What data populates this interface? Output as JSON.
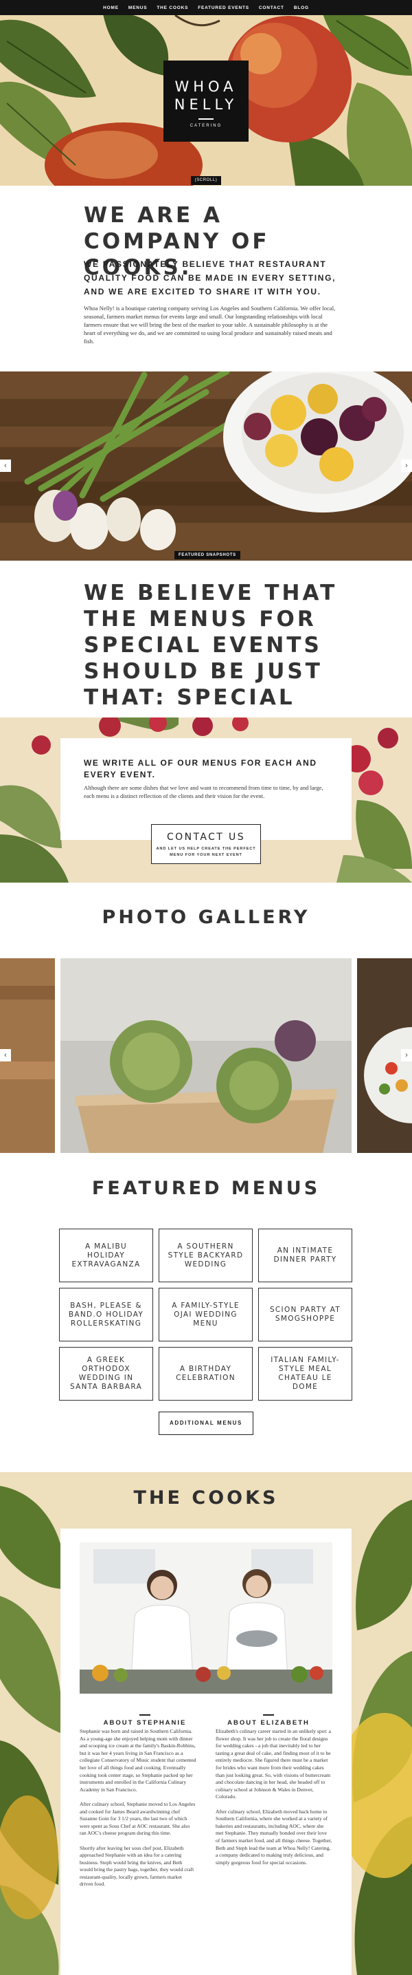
{
  "nav": {
    "items": [
      "HOME",
      "MENUS",
      "THE COOKS",
      "FEATURED EVENTS",
      "CONTACT",
      "BLOG"
    ]
  },
  "hero": {
    "logo_line1": "WHOA",
    "logo_line2": "NELLY",
    "logo_sub": "CATERING",
    "scroll_label": "(SCROLL)"
  },
  "intro": {
    "heading": "WE ARE A COMPANY OF COOKS.",
    "lead": "WE PASSIONATELY BELIEVE THAT RESTAURANT QUALITY FOOD CAN BE MADE IN EVERY SETTING, AND WE ARE EXCITED TO SHARE IT WITH YOU.",
    "body": "Whoa Nelly! is a boutique catering company serving Los Angeles and Southern California. We offer local, seasonal, farmers market menus for events large and small. Our longstanding relationships with local farmers ensure that we will bring the best of the market to your table. A sustainable philosophy is at the heart of everything we do, and we are committed to using local produce and sustainably raised meats and fish."
  },
  "band1": {
    "tag": "FEATURED SNAPSHOTS",
    "arrow_left": "‹",
    "arrow_right": "›"
  },
  "believe": {
    "heading": "WE BELIEVE THAT THE MENUS FOR SPECIAL EVENTS SHOULD BE JUST THAT: SPECIAL"
  },
  "menus_feature": {
    "title": "WE WRITE ALL OF OUR MENUS FOR EACH AND EVERY EVENT.",
    "text": "Although there are some dishes that we love and want to recommend from time to time, by and large, each menu is a distinct reflection of the clients and their vision for the event.",
    "contact_label": "CONTACT US",
    "contact_sub": "AND LET US HELP CREATE THE PERFECT MENU FOR YOUR NEXT EVENT"
  },
  "gallery": {
    "title": "PHOTO GALLERY",
    "arrow_left": "‹",
    "arrow_right": "›"
  },
  "featured_menus": {
    "title": "FEATURED MENUS",
    "items": [
      "A MALIBU HOLIDAY EXTRAVAGANZA",
      "A SOUTHERN STYLE BACKYARD WEDDING",
      "AN INTIMATE DINNER PARTY",
      "BASH, PLEASE & BAND.O HOLIDAY ROLLERSKATING",
      "A FAMILY-STYLE OJAI WEDDING MENU",
      "SCION PARTY AT SMOGSHOPPE",
      "A GREEK ORTHODOX WEDDING IN SANTA BARBARA",
      "A BIRTHDAY CELEBRATION",
      "ITALIAN FAMILY-STYLE MEAL CHATEAU LE DOME"
    ],
    "more_label": "ADDITIONAL MENUS"
  },
  "cooks": {
    "title": "THE COOKS",
    "about_left": "ABOUT STEPHANIE",
    "about_right": "ABOUT ELIZABETH",
    "left_paragraphs": [
      "Stephanie was born and raised in Southern California. As a young-age she enjoyed helping mom with dinner and scooping ice cream at the family's Baskin-Robbins, but it was her 4 years living in San Francisco as a collegiate Conservatory of Music student that cemented her love of all things food and cooking. Eventually cooking took center stage, so Stephanie packed up her instruments and enrolled in the California Culinary Academy in San Francisco.",
      "After culinary school, Stephanie moved to Los Angeles and cooked for James Beard awardwinning chef Suzanne Goin for 3 1/2 years, the last two of which were spent as Sous Chef at AOC restaurant. She also ran AOC's cheese program during this time.",
      "Shortly after leaving her sous chef post, Elizabeth approached Stephanie with an idea for a catering business. Steph would bring the knives, and Beth would bring the pastry bags, together, they would craft restaurant-quality, locally grown, farmers market driven food."
    ],
    "right_paragraphs": [
      "Elizabeth's culinary career started in an unlikely spot: a flower shop. It was her job to create the floral designs for wedding cakes - a job that inevitably led to her tasting a great deal of cake, and finding most of it to be entirely mediocre. She figured there must be a market for brides who want more from their wedding cakes than just looking great. So, with visions of buttercream and chocolate dancing in her head, she headed off to culinary school at Johnson & Wales in Denver, Colorado.",
      "After culinary school, Elizabeth moved back home to Southern California, where she worked at a variety of bakeries and restaurants, including AOC, where she met Stephanie. They mutually bonded over their love of farmers market food, and all things cheese. Together, Beth and Steph lead the team at Whoa Nelly! Catering, a company dedicated to making truly delicious, and simply gorgeous food for special occasions."
    ]
  }
}
